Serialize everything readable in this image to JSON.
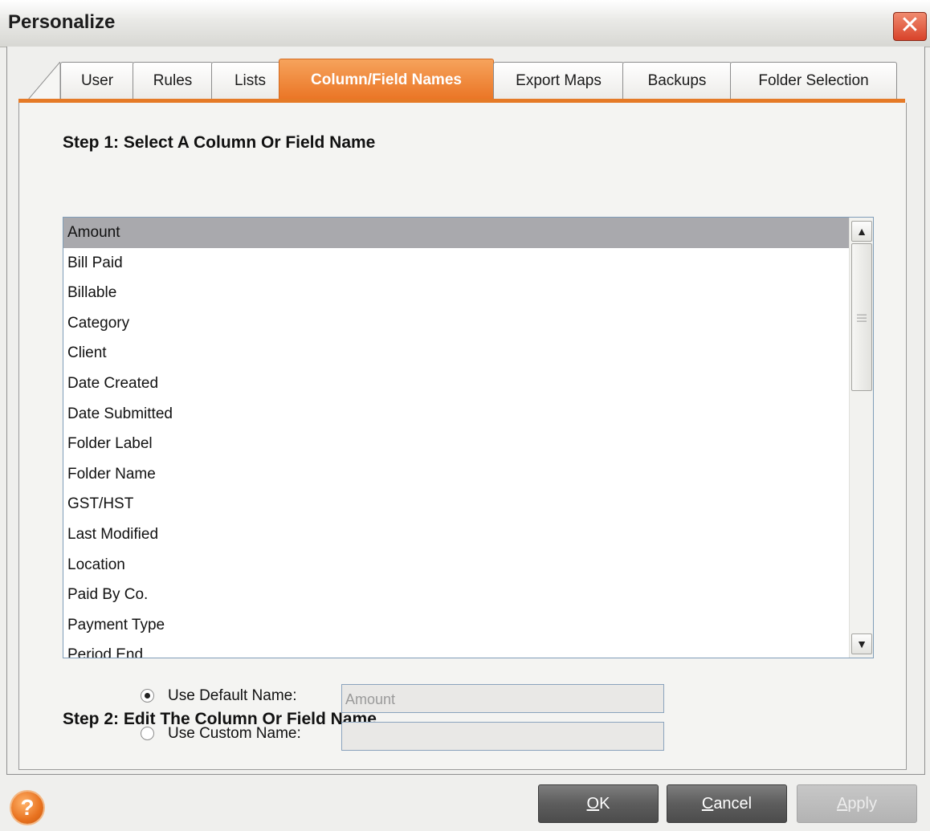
{
  "window": {
    "title": "Personalize"
  },
  "tabs": [
    {
      "label": "User",
      "active": false
    },
    {
      "label": "Rules",
      "active": false
    },
    {
      "label": "Lists",
      "active": false
    },
    {
      "label": "Column/Field Names",
      "active": true
    },
    {
      "label": "Export Maps",
      "active": false
    },
    {
      "label": "Backups",
      "active": false
    },
    {
      "label": "Folder Selection",
      "active": false
    }
  ],
  "step1": {
    "heading": "Step 1: Select A Column Or Field Name",
    "items": [
      "Amount",
      "Bill Paid",
      "Billable",
      "Category",
      "Client",
      "Date Created",
      "Date Submitted",
      "Folder Label",
      "Folder Name",
      "GST/HST",
      "Last Modified",
      "Location",
      "Paid By Co.",
      "Payment Type",
      "Period End"
    ],
    "selected": "Amount"
  },
  "step2": {
    "heading": "Step 2: Edit The Column Or Field Name",
    "default_label": "Use Default Name:",
    "default_value": "Amount",
    "custom_label": "Use Custom Name:",
    "custom_value": "",
    "selected_option": "default"
  },
  "buttons": {
    "ok_key": "O",
    "ok_rest": "K",
    "cancel_key": "C",
    "cancel_rest": "ancel",
    "apply_key": "A",
    "apply_rest": "pply"
  },
  "icons": {
    "close": "close-icon",
    "help": "help-icon",
    "scroll_up": "chevron-up-icon",
    "scroll_down": "chevron-down-icon"
  },
  "colors": {
    "accent": "#ea7424",
    "selection": "#a9a9ad",
    "close": "#d8432a"
  }
}
